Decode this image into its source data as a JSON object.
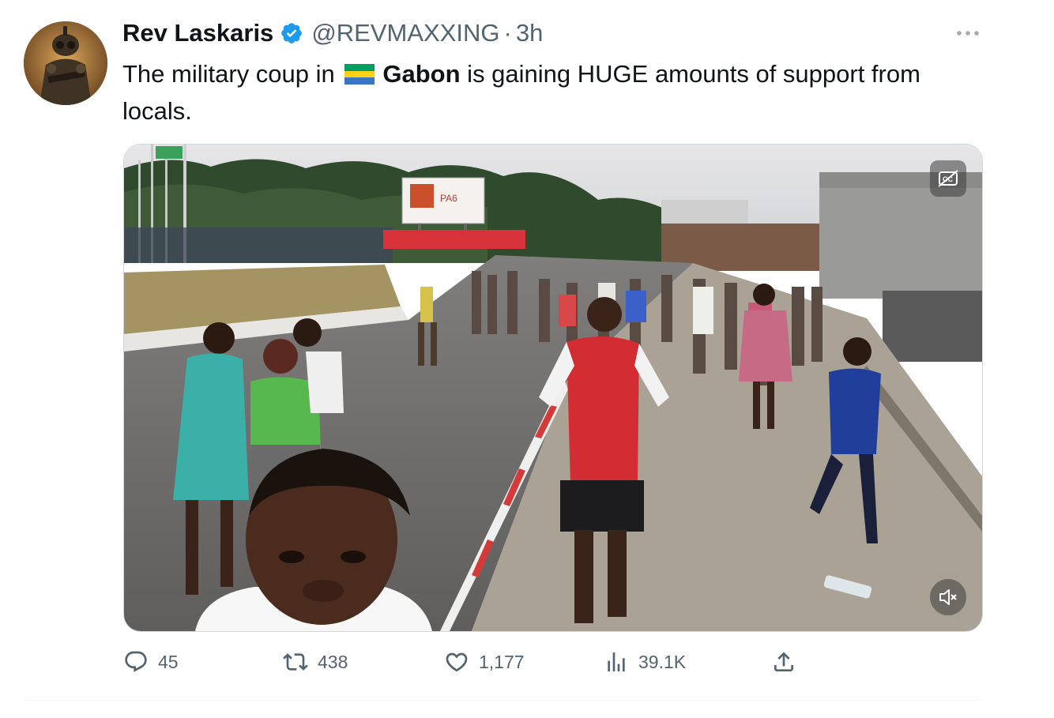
{
  "author": {
    "display_name": "Rev Laskaris",
    "handle": "@REVMAXXING",
    "separator": "·",
    "time": "3h",
    "verified": true
  },
  "tweet": {
    "text_before": "The military coup in ",
    "flag_icon": "gabon-flag-icon",
    "bold_word": "Gabon",
    "text_after": " is gaining HUGE amounts of support from locals."
  },
  "media": {
    "type": "video",
    "captions_icon": "captions-off-icon",
    "mute_icon": "muted-speaker-icon",
    "billboard_text": "PA6"
  },
  "actions": {
    "replies": "45",
    "retweets": "438",
    "likes": "1,177",
    "views": "39.1K"
  },
  "colors": {
    "verified_blue": "#1d9bf0",
    "text_secondary": "#536471",
    "gabon_green": "#009e60",
    "gabon_yellow": "#fcd116",
    "gabon_blue": "#3a75c4"
  }
}
